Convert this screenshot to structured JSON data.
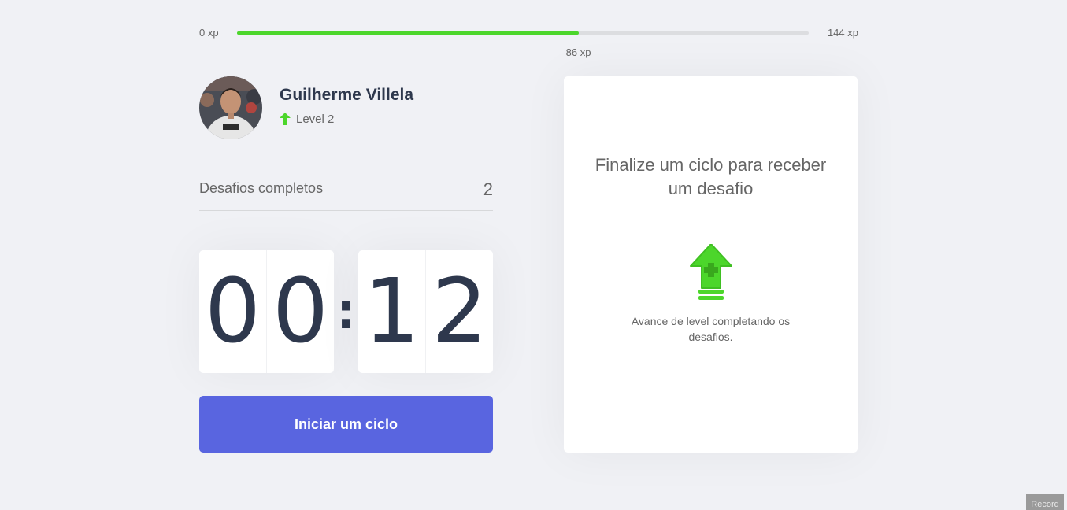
{
  "experience": {
    "min_label": "0 xp",
    "max_label": "144 xp",
    "current_label": "86 xp",
    "current": 86,
    "max": 144
  },
  "profile": {
    "name": "Guilherme Villela",
    "level_label": "Level 2",
    "avatar_icon": "user-photo"
  },
  "completed_challenges": {
    "label": "Desafios completos",
    "count": "2"
  },
  "countdown": {
    "minute_left": "0",
    "minute_right": "0",
    "separator": ":",
    "second_left": "1",
    "second_right": "2"
  },
  "actions": {
    "start_cycle_label": "Iniciar um ciclo"
  },
  "challenge_box": {
    "title": "Finalize um ciclo para receber um desafio",
    "hint": "Avance de level completando os desafios.",
    "icon": "level-up-arrow-icon"
  },
  "overlay": {
    "record_label": "Record"
  },
  "colors": {
    "background": "#f0f1f5",
    "accent_green": "#4cd62b",
    "button_blue": "#5965e0",
    "title_dark": "#2e384d",
    "text": "#666666"
  }
}
